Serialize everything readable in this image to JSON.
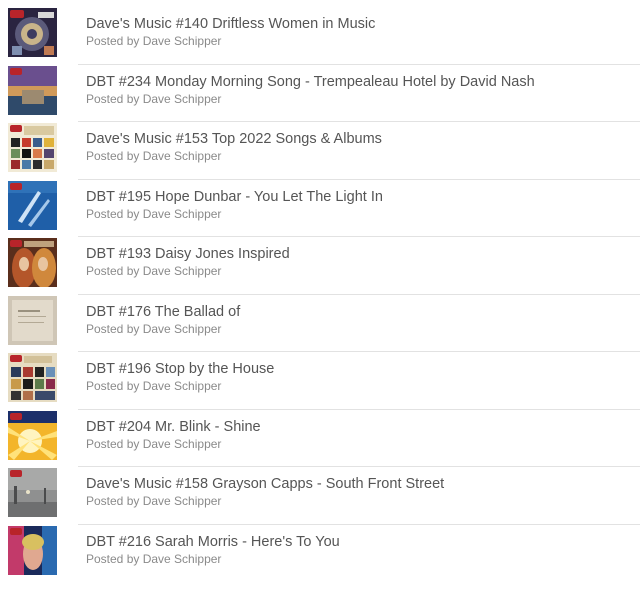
{
  "posts": [
    {
      "title": "Dave's Music #140 Driftless Women in Music",
      "byline": "Posted by Dave Schipper",
      "thumbnail": "radio-logo-collage-dark-purple"
    },
    {
      "title": "DBT #234 Monday Morning Song - Trempealeau Hotel by David Nash",
      "byline": "Posted by Dave Schipper",
      "thumbnail": "painting-sunset-purple"
    },
    {
      "title": "Dave's Music #153 Top 2022 Songs & Albums",
      "byline": "Posted by Dave Schipper",
      "thumbnail": "album-grid-cream"
    },
    {
      "title": "DBT #195 Hope Dunbar - You Let The Light In",
      "byline": "Posted by Dave Schipper",
      "thumbnail": "blue-album-cover"
    },
    {
      "title": "DBT #193 Daisy Jones Inspired",
      "byline": "Posted by Dave Schipper",
      "thumbnail": "portrait-warm-orange"
    },
    {
      "title": "DBT #176 The Ballad of",
      "byline": "Posted by Dave Schipper",
      "thumbnail": "paper-note-beige"
    },
    {
      "title": "DBT #196 Stop by the House",
      "byline": "Posted by Dave Schipper",
      "thumbnail": "album-grid-cream"
    },
    {
      "title": "DBT #204 Mr. Blink - Shine",
      "byline": "Posted by Dave Schipper",
      "thumbnail": "sunburst-yellow"
    },
    {
      "title": "Dave's Music #158 Grayson Capps - South Front Street",
      "byline": "Posted by Dave Schipper",
      "thumbnail": "foggy-street-gray"
    },
    {
      "title": "DBT #216 Sarah Morris - Here's To You",
      "byline": "Posted by Dave Schipper",
      "thumbnail": "neon-portrait-blue-red"
    }
  ]
}
